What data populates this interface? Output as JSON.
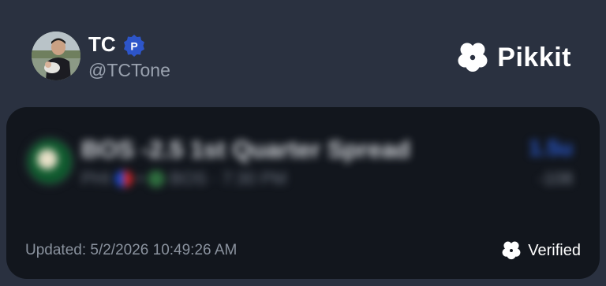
{
  "user": {
    "name": "TC",
    "handle": "@TCTone",
    "badge_letter": "P"
  },
  "brand": {
    "name": "Pikkit",
    "icon": "clover-icon"
  },
  "bet": {
    "title": "BOS -2.5 1st Quarter Spread",
    "away_team": "PHI",
    "home_team": "BOS",
    "separator": "•",
    "time": "BOS · 7:30 PM",
    "line": "1.5u",
    "odds": "-108",
    "blurred": true
  },
  "card": {
    "updated": "Updated: 5/2/2026 10:49:26 AM",
    "verified_label": "Verified"
  },
  "colors": {
    "page_bg": "#2a3140",
    "card_bg": "#12161d",
    "badge": "#2d55c9"
  }
}
